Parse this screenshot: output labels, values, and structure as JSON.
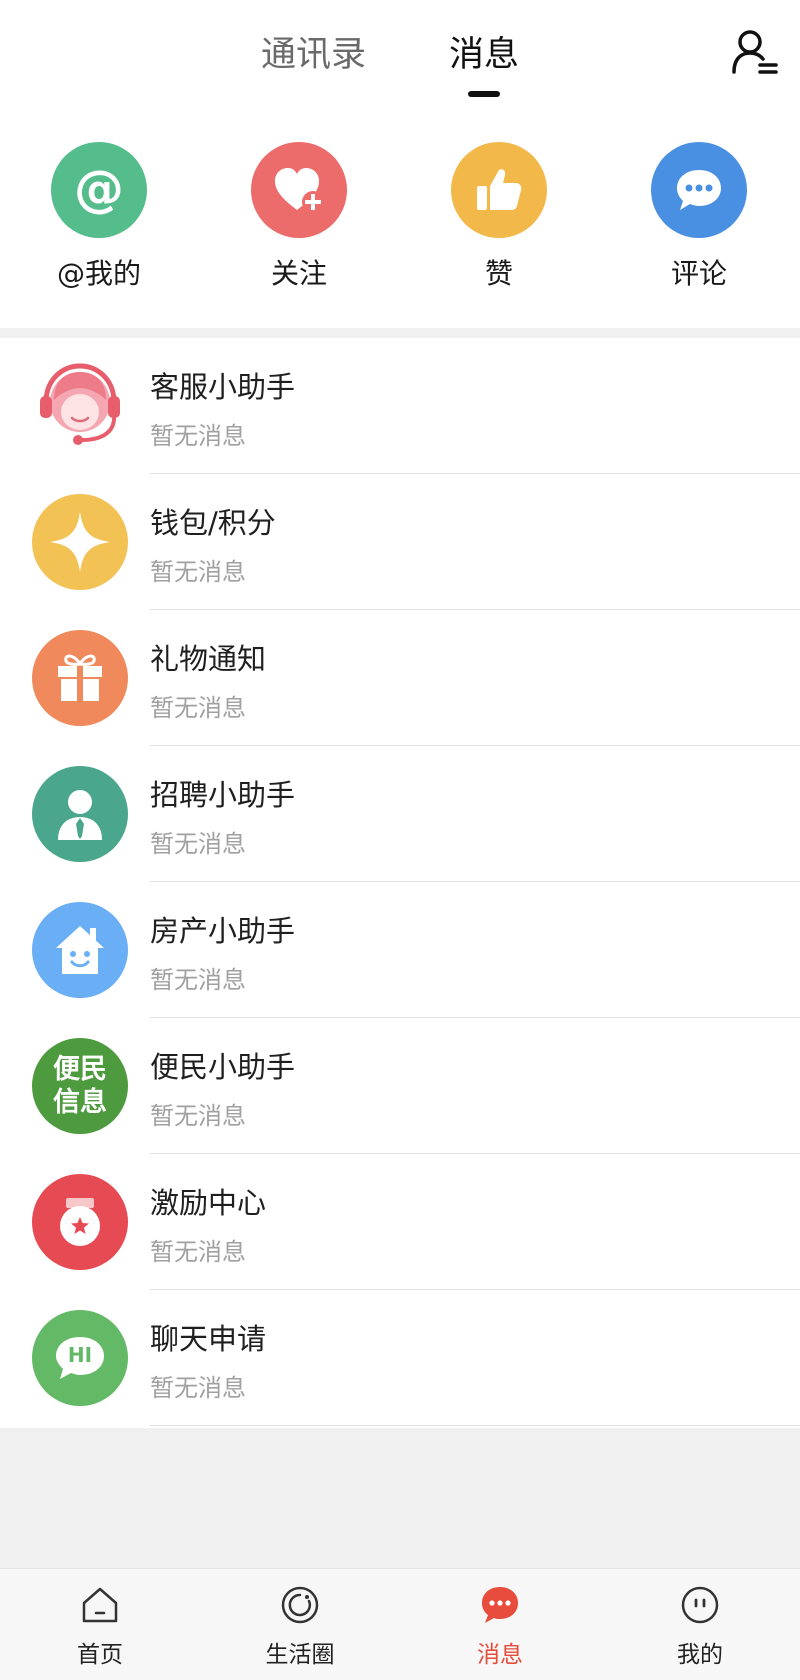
{
  "header": {
    "tabs": [
      {
        "label": "通讯录",
        "active": false
      },
      {
        "label": "消息",
        "active": true
      }
    ],
    "profile_icon": "user-list-icon"
  },
  "quick_actions": [
    {
      "label": "@我的",
      "icon": "at-icon",
      "color": "#55bd8c"
    },
    {
      "label": "关注",
      "icon": "heart-plus-icon",
      "color": "#ec6b6b"
    },
    {
      "label": "赞",
      "icon": "thumbs-up-icon",
      "color": "#f2b84a"
    },
    {
      "label": "评论",
      "icon": "comment-icon",
      "color": "#4a90e2"
    }
  ],
  "messages": [
    {
      "title": "客服小助手",
      "subtitle": "暂无消息",
      "icon": "customer-service-icon",
      "color": "#f4a7b0"
    },
    {
      "title": "钱包/积分",
      "subtitle": "暂无消息",
      "icon": "wallet-points-icon",
      "color": "#f2c255"
    },
    {
      "title": "礼物通知",
      "subtitle": "暂无消息",
      "icon": "gift-icon",
      "color": "#f08a5d"
    },
    {
      "title": "招聘小助手",
      "subtitle": "暂无消息",
      "icon": "recruit-icon",
      "color": "#4aa68c"
    },
    {
      "title": "房产小助手",
      "subtitle": "暂无消息",
      "icon": "house-icon",
      "color": "#6aaef5"
    },
    {
      "title": "便民小助手",
      "subtitle": "暂无消息",
      "icon": "convenience-info-icon",
      "color": "#4e9a3e",
      "icon_text": [
        "便民",
        "信息"
      ]
    },
    {
      "title": "激励中心",
      "subtitle": "暂无消息",
      "icon": "medal-icon",
      "color": "#e64a52"
    },
    {
      "title": "聊天申请",
      "subtitle": "暂无消息",
      "icon": "chat-hi-icon",
      "color": "#63b966",
      "icon_text": [
        "HI"
      ]
    }
  ],
  "bottom_nav": [
    {
      "label": "首页",
      "icon": "home-icon",
      "active": false
    },
    {
      "label": "生活圈",
      "icon": "life-circle-icon",
      "active": false
    },
    {
      "label": "消息",
      "icon": "message-icon",
      "active": true
    },
    {
      "label": "我的",
      "icon": "profile-face-icon",
      "active": false
    }
  ],
  "accent_color": "#e74c3c"
}
